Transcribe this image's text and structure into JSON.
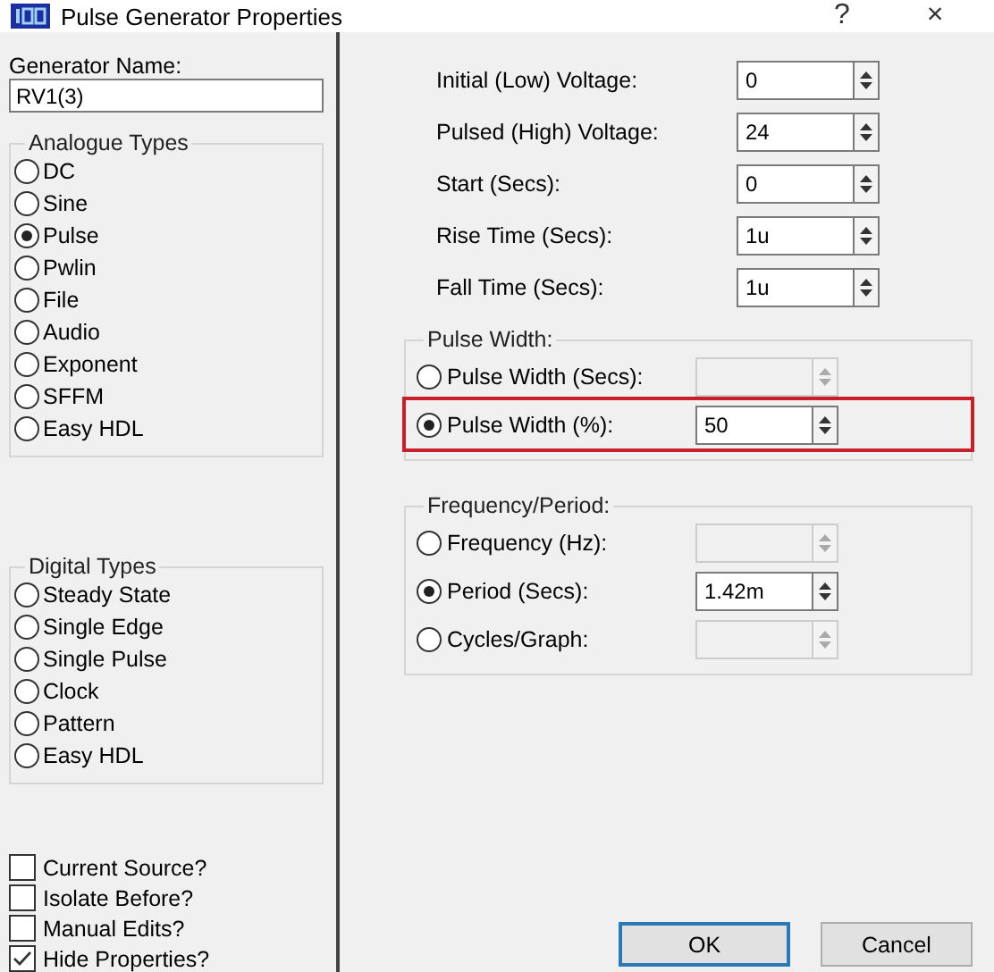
{
  "window": {
    "title": "Pulse Generator Properties",
    "controls": [
      "?",
      "×"
    ]
  },
  "generator_name": {
    "label": "Generator Name:",
    "value": "RV1(3)"
  },
  "analogue_types": {
    "title": "Analogue Types",
    "options": [
      {
        "label": "DC",
        "selected": false
      },
      {
        "label": "Sine",
        "selected": false
      },
      {
        "label": "Pulse",
        "selected": true
      },
      {
        "label": "Pwlin",
        "selected": false
      },
      {
        "label": "File",
        "selected": false
      },
      {
        "label": "Audio",
        "selected": false
      },
      {
        "label": "Exponent",
        "selected": false
      },
      {
        "label": "SFFM",
        "selected": false
      },
      {
        "label": "Easy HDL",
        "selected": false
      }
    ]
  },
  "digital_types": {
    "title": "Digital Types",
    "options": [
      {
        "label": "Steady State",
        "selected": false
      },
      {
        "label": "Single Edge",
        "selected": false
      },
      {
        "label": "Single Pulse",
        "selected": false
      },
      {
        "label": "Clock",
        "selected": false
      },
      {
        "label": "Pattern",
        "selected": false
      },
      {
        "label": "Easy HDL",
        "selected": false
      }
    ]
  },
  "options": [
    {
      "label": "Current Source?",
      "checked": false
    },
    {
      "label": "Isolate Before?",
      "checked": false
    },
    {
      "label": "Manual Edits?",
      "checked": false
    },
    {
      "label": "Hide Properties?",
      "checked": true
    }
  ],
  "parameters": [
    {
      "label": "Initial (Low) Voltage:",
      "value": "0"
    },
    {
      "label": "Pulsed (High) Voltage:",
      "value": "24"
    },
    {
      "label": "Start (Secs):",
      "value": "0"
    },
    {
      "label": "Rise Time (Secs):",
      "value": "1u"
    },
    {
      "label": "Fall Time (Secs):",
      "value": "1u"
    }
  ],
  "pulse_width": {
    "title": "Pulse Width:",
    "options": [
      {
        "label": "Pulse Width (Secs):",
        "selected": false,
        "highlighted": false
      },
      {
        "label": "Pulse Width (%):",
        "value": "50",
        "selected": true,
        "highlighted": true
      }
    ]
  },
  "frequency_period": {
    "title": "Frequency/Period:",
    "options": [
      {
        "label": "Frequency (Hz):",
        "selected": false
      },
      {
        "label": "Period (Secs):",
        "value": "1.42m",
        "selected": true
      },
      {
        "label": "Cycles/Graph:",
        "selected": false
      }
    ]
  },
  "buttons": [
    {
      "label": "OK",
      "default": true
    },
    {
      "label": "Cancel",
      "default": false
    }
  ]
}
